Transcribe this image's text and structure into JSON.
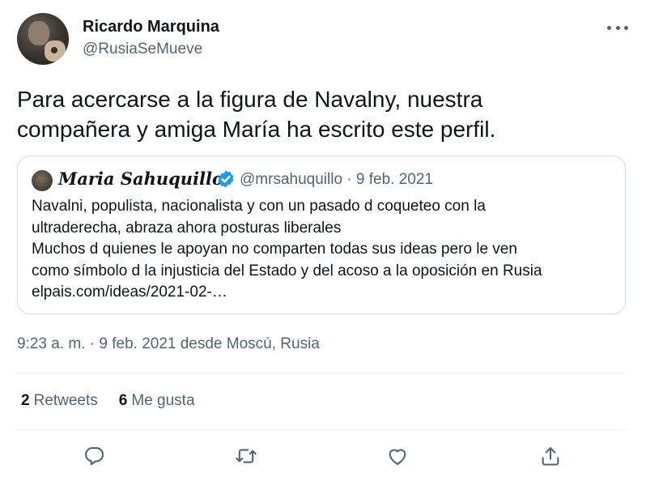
{
  "author": {
    "name": "Ricardo Marquina",
    "handle": "@RusiaSeMueve"
  },
  "tweet": {
    "text_line1": "Para acercarse a la figura de Navalny, nuestra",
    "text_line2": "compañera y amiga María ha escrito este perfil."
  },
  "quoted": {
    "name": "Maria Sahuquillo",
    "handle": "@mrsahuquillo",
    "separator": "·",
    "date": "9 feb. 2021",
    "lines": [
      "Navalni, populista, nacionalista y con un pasado d coqueteo con la",
      "ultraderecha, abraza ahora posturas liberales",
      "Muchos d quienes le apoyan no comparten todas sus ideas pero le ven",
      "como símbolo d la injusticia del Estado y del acoso a la oposición en Rusia",
      "elpais.com/ideas/2021-02-…"
    ]
  },
  "timestamp": "9:23 a. m. · 9 feb. 2021 desde Moscú, Rusia",
  "stats": {
    "retweets_count": "2",
    "retweets_label": "Retweets",
    "likes_count": "6",
    "likes_label": "Me gusta"
  },
  "icons": {
    "more": "more-horizontal-icon",
    "verified": "verified-badge-icon",
    "reply": "reply-icon",
    "retweet": "retweet-icon",
    "like": "like-icon",
    "share": "share-icon"
  },
  "colors": {
    "text_primary": "#0f1419",
    "text_secondary": "#536471",
    "verified_blue": "#1d9bf0",
    "border": "#cfd9de",
    "divider": "#eff3f4"
  }
}
